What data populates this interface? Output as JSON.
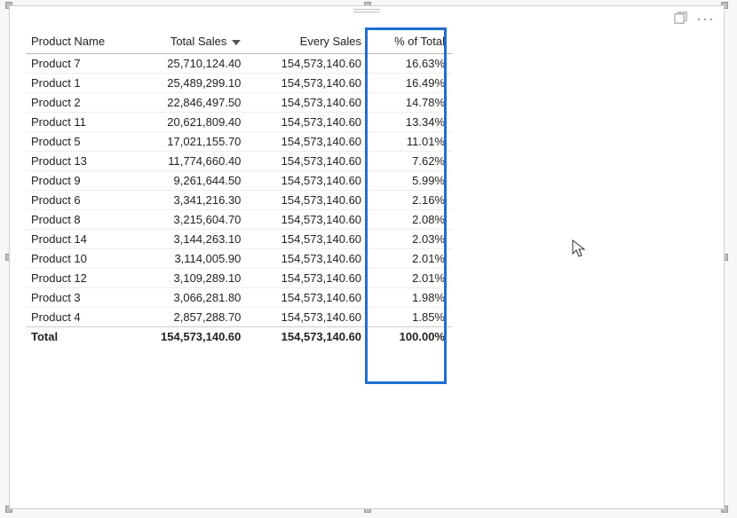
{
  "columns": {
    "name": "Product Name",
    "sales": "Total Sales",
    "every": "Every Sales",
    "pct": "% of Total"
  },
  "sort_column": "sales",
  "rows": [
    {
      "name": "Product 7",
      "sales": "25,710,124.40",
      "every": "154,573,140.60",
      "pct": "16.63%"
    },
    {
      "name": "Product 1",
      "sales": "25,489,299.10",
      "every": "154,573,140.60",
      "pct": "16.49%"
    },
    {
      "name": "Product 2",
      "sales": "22,846,497.50",
      "every": "154,573,140.60",
      "pct": "14.78%"
    },
    {
      "name": "Product 11",
      "sales": "20,621,809.40",
      "every": "154,573,140.60",
      "pct": "13.34%"
    },
    {
      "name": "Product 5",
      "sales": "17,021,155.70",
      "every": "154,573,140.60",
      "pct": "11.01%"
    },
    {
      "name": "Product 13",
      "sales": "11,774,660.40",
      "every": "154,573,140.60",
      "pct": "7.62%"
    },
    {
      "name": "Product 9",
      "sales": "9,261,644.50",
      "every": "154,573,140.60",
      "pct": "5.99%"
    },
    {
      "name": "Product 6",
      "sales": "3,341,216.30",
      "every": "154,573,140.60",
      "pct": "2.16%"
    },
    {
      "name": "Product 8",
      "sales": "3,215,604.70",
      "every": "154,573,140.60",
      "pct": "2.08%"
    },
    {
      "name": "Product 14",
      "sales": "3,144,263.10",
      "every": "154,573,140.60",
      "pct": "2.03%"
    },
    {
      "name": "Product 10",
      "sales": "3,114,005.90",
      "every": "154,573,140.60",
      "pct": "2.01%"
    },
    {
      "name": "Product 12",
      "sales": "3,109,289.10",
      "every": "154,573,140.60",
      "pct": "2.01%"
    },
    {
      "name": "Product 3",
      "sales": "3,066,281.80",
      "every": "154,573,140.60",
      "pct": "1.98%"
    },
    {
      "name": "Product 4",
      "sales": "2,857,288.70",
      "every": "154,573,140.60",
      "pct": "1.85%"
    }
  ],
  "total": {
    "label": "Total",
    "sales": "154,573,140.60",
    "every": "154,573,140.60",
    "pct": "100.00%"
  },
  "chart_data": {
    "type": "table",
    "title": "",
    "columns": [
      "Product Name",
      "Total Sales",
      "Every Sales",
      "% of Total"
    ],
    "rows": [
      [
        "Product 7",
        25710124.4,
        154573140.6,
        16.63
      ],
      [
        "Product 1",
        25489299.1,
        154573140.6,
        16.49
      ],
      [
        "Product 2",
        22846497.5,
        154573140.6,
        14.78
      ],
      [
        "Product 11",
        20621809.4,
        154573140.6,
        13.34
      ],
      [
        "Product 5",
        17021155.7,
        154573140.6,
        11.01
      ],
      [
        "Product 13",
        11774660.4,
        154573140.6,
        7.62
      ],
      [
        "Product 9",
        9261644.5,
        154573140.6,
        5.99
      ],
      [
        "Product 6",
        3341216.3,
        154573140.6,
        2.16
      ],
      [
        "Product 8",
        3215604.7,
        154573140.6,
        2.08
      ],
      [
        "Product 14",
        3144263.1,
        154573140.6,
        2.03
      ],
      [
        "Product 10",
        3114005.9,
        154573140.6,
        2.01
      ],
      [
        "Product 12",
        3109289.1,
        154573140.6,
        2.01
      ],
      [
        "Product 3",
        3066281.8,
        154573140.6,
        1.98
      ],
      [
        "Product 4",
        2857288.7,
        154573140.6,
        1.85
      ]
    ],
    "total_row": [
      "Total",
      154573140.6,
      154573140.6,
      100.0
    ]
  }
}
